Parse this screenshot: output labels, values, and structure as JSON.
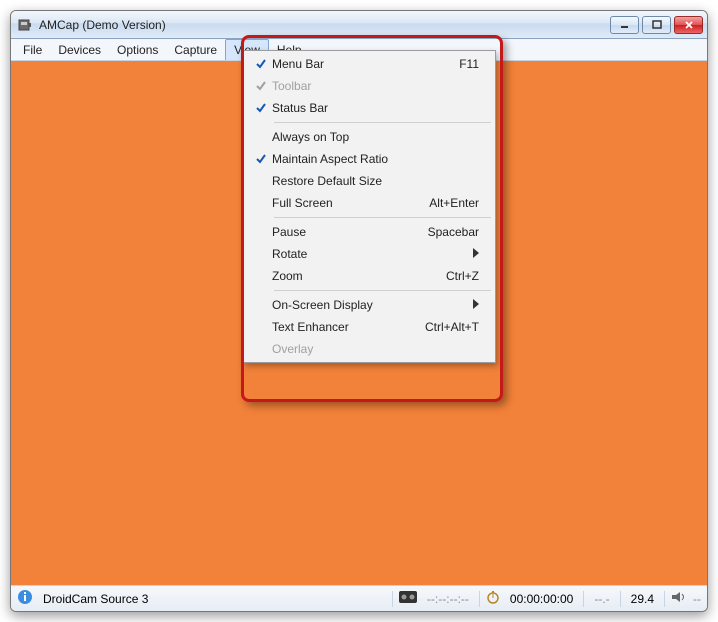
{
  "window": {
    "title": "AMCap (Demo Version)"
  },
  "menu": {
    "items": [
      "File",
      "Devices",
      "Options",
      "Capture",
      "View",
      "Help"
    ],
    "active": "View"
  },
  "dropdown": {
    "rows": [
      {
        "checked": true,
        "label": "Menu Bar",
        "accel": "F11"
      },
      {
        "checked": true,
        "label": "Toolbar",
        "accel": "",
        "disabled": true
      },
      {
        "checked": true,
        "label": "Status Bar",
        "accel": ""
      },
      {
        "sep": true
      },
      {
        "checked": false,
        "label": "Always on Top",
        "accel": ""
      },
      {
        "checked": true,
        "label": "Maintain Aspect Ratio",
        "accel": ""
      },
      {
        "checked": false,
        "label": "Restore Default Size",
        "accel": ""
      },
      {
        "checked": false,
        "label": "Full Screen",
        "accel": "Alt+Enter"
      },
      {
        "sep": true
      },
      {
        "checked": false,
        "label": "Pause",
        "accel": "Spacebar"
      },
      {
        "checked": false,
        "label": "Rotate",
        "accel": "",
        "submenu": true
      },
      {
        "checked": false,
        "label": "Zoom",
        "accel": "Ctrl+Z"
      },
      {
        "sep": true
      },
      {
        "checked": false,
        "label": "On-Screen Display",
        "accel": "",
        "submenu": true
      },
      {
        "checked": false,
        "label": "Text Enhancer",
        "accel": "Ctrl+Alt+T"
      },
      {
        "checked": false,
        "label": "Overlay",
        "accel": "",
        "disabled": true
      }
    ]
  },
  "status": {
    "source": "DroidCam Source 3",
    "tape_time": "--:--:--:--",
    "clock_time": "00:00:00:00",
    "dropped": "--.-",
    "fps": "29.4"
  }
}
